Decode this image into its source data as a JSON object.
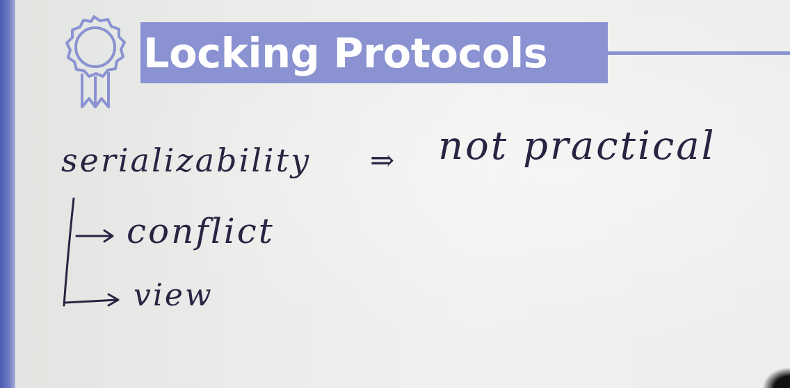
{
  "slide": {
    "title": "Locking Protocols",
    "icon": "award-ribbon-icon",
    "colors": {
      "accent": "#8a92d2",
      "left_band": "#4a5bb0",
      "ink": "#2a2342"
    }
  },
  "notes": {
    "line1_left": "serializability",
    "line1_arrow": "⇒",
    "line1_right": "not practical",
    "branch1": "conflict",
    "branch2": "view"
  }
}
